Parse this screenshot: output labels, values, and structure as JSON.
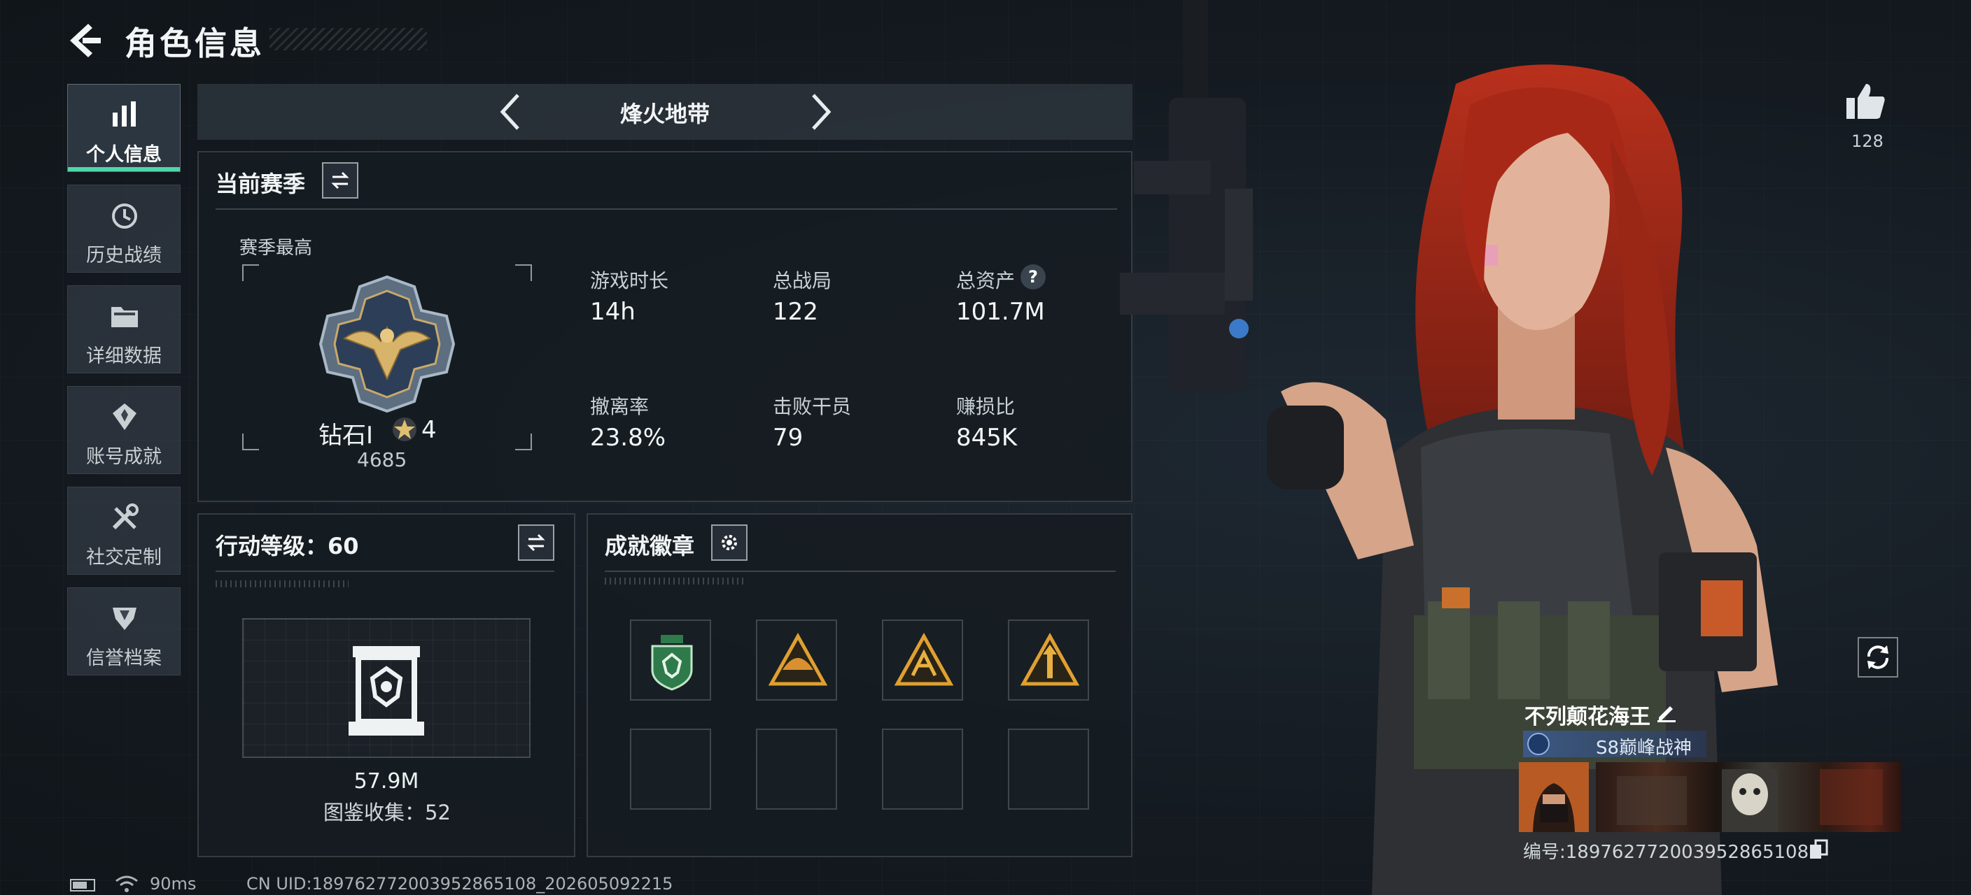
{
  "header": {
    "title": "角色信息"
  },
  "sidebar": {
    "items": [
      {
        "label": "个人信息",
        "icon": "bar-chart-icon",
        "active": true
      },
      {
        "label": "历史战绩",
        "icon": "history-icon"
      },
      {
        "label": "详细数据",
        "icon": "folder-icon"
      },
      {
        "label": "账号成就",
        "icon": "medal-icon"
      },
      {
        "label": "社交定制",
        "icon": "tools-icon"
      },
      {
        "label": "信誉档案",
        "icon": "shield-icon"
      }
    ],
    "accent": "#4fd6a8"
  },
  "mode": {
    "title": "烽火地带"
  },
  "season": {
    "title": "当前赛季",
    "best_label": "赛季最高",
    "rank_name": "钻石Ⅰ",
    "rank_level": "4",
    "rank_score": "4685",
    "stats": [
      {
        "label": "游戏时长",
        "value": "14h"
      },
      {
        "label": "总战局",
        "value": "122"
      },
      {
        "label": "总资产",
        "value": "101.7M"
      },
      {
        "label": "撤离率",
        "value": "23.8%"
      },
      {
        "label": "击败干员",
        "value": "79"
      },
      {
        "label": "赚损比",
        "value": "845K"
      }
    ],
    "help": "?"
  },
  "action": {
    "title": "行动等级：60",
    "collection_value": "57.9M",
    "collection_label": "图鉴收集：52"
  },
  "achievements": {
    "title": "成就徽章"
  },
  "profile": {
    "likes": "128",
    "name": "不列颠花海王",
    "badge_title": "S8巅峰战神",
    "id": "编号:1897627720039528651​08"
  },
  "status": {
    "ping": "90ms",
    "uid": "CN UID:1897627720039528651​08_202605092215"
  }
}
